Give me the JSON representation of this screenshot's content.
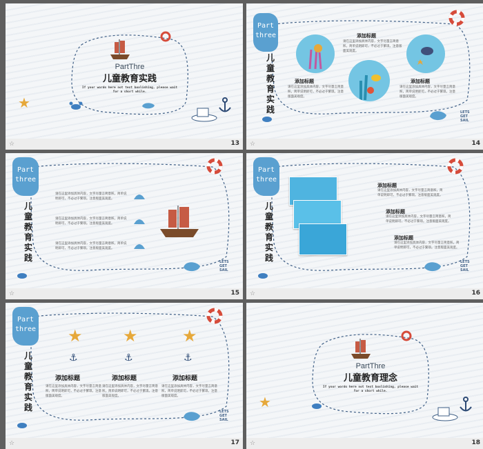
{
  "slides": [
    {
      "num": "13",
      "title_en": "PartThre",
      "title_cn": "儿童教育实践",
      "small": "If your words here not text boxlishing, please wait for a short while."
    },
    {
      "num": "14",
      "blob": "Part three",
      "vertical": "儿童教育实践",
      "h1": "添加标题",
      "h2": "添加标题",
      "h3": "添加标题",
      "p1": "请在这里添加具体内容，文字尽量言简意赅，简单说明即可，不必过于繁琐。注意版面美观度。",
      "p2": "请在这里添加具体内容，文字尽量言简意赅，简单说明即可，不必过于繁琐。注意版面美观度。",
      "p3": "请在这里添加具体内容，文字尽量言简意赅，简单说明即可，不必过于繁琐。注意版面美观度。"
    },
    {
      "num": "15",
      "blob": "Part three",
      "vertical": "儿童教育实践",
      "p1": "请在这里添加具体内容，文字尽量言简意赅，简单说明即可，不必过于繁琐。注意版面美观度。",
      "p2": "请在这里添加具体内容，文字尽量言简意赅，简单说明即可，不必过于繁琐。注意版面美观度。",
      "p3": "请在这里添加具体内容，文字尽量言简意赅，简单说明即可，不必过于繁琐。注意版面美观度。"
    },
    {
      "num": "16",
      "blob": "Part three",
      "vertical": "儿童教育实践",
      "h1": "添加标题",
      "h2": "添加标题",
      "h3": "添加标题",
      "p1": "请在这里添加具体内容，文字尽量言简意赅，简单说明即可，不必过于繁琐。注意版面美观度。",
      "p2": "请在这里添加具体内容，文字尽量言简意赅，简单说明即可，不必过于繁琐。注意版面美观度。",
      "p3": "请在这里添加具体内容，文字尽量言简意赅，简单说明即可，不必过于繁琐。注意版面美观度。"
    },
    {
      "num": "17",
      "blob": "Part three",
      "vertical": "儿童教育实践",
      "h1": "添加标题",
      "h2": "添加标题",
      "h3": "添加标题",
      "p1": "请在这里添加具体内容，文字尽量言简意赅，简单说明即可，不必过于繁琐。注意版面美观度。",
      "p2": "请在这里添加具体内容，文字尽量言简意赅，简单说明即可，不必过于繁琐。注意版面美观度。",
      "p3": "请在这里添加具体内容，文字尽量言简意赅，简单说明即可，不必过于繁琐。注意版面美观度。"
    },
    {
      "num": "18",
      "title_en": "PartThre",
      "title_cn": "儿童教育理念",
      "small": "If your words here not text boxlishing, please wait for a short while."
    }
  ],
  "sail_text": "LETS GET SAIL",
  "icons": {
    "slide_icon": "slide-icon",
    "star": "star-icon",
    "anchor": "anchor-icon",
    "lifebuoy": "lifebuoy-icon",
    "whale": "whale-icon",
    "crab": "crab-icon",
    "ship": "ship-icon",
    "shell": "shell-icon"
  },
  "colors": {
    "accent": "#5aa0d0",
    "dash": "#3f5f86",
    "star": "#e6a83a",
    "sea": "#74c5e3"
  }
}
